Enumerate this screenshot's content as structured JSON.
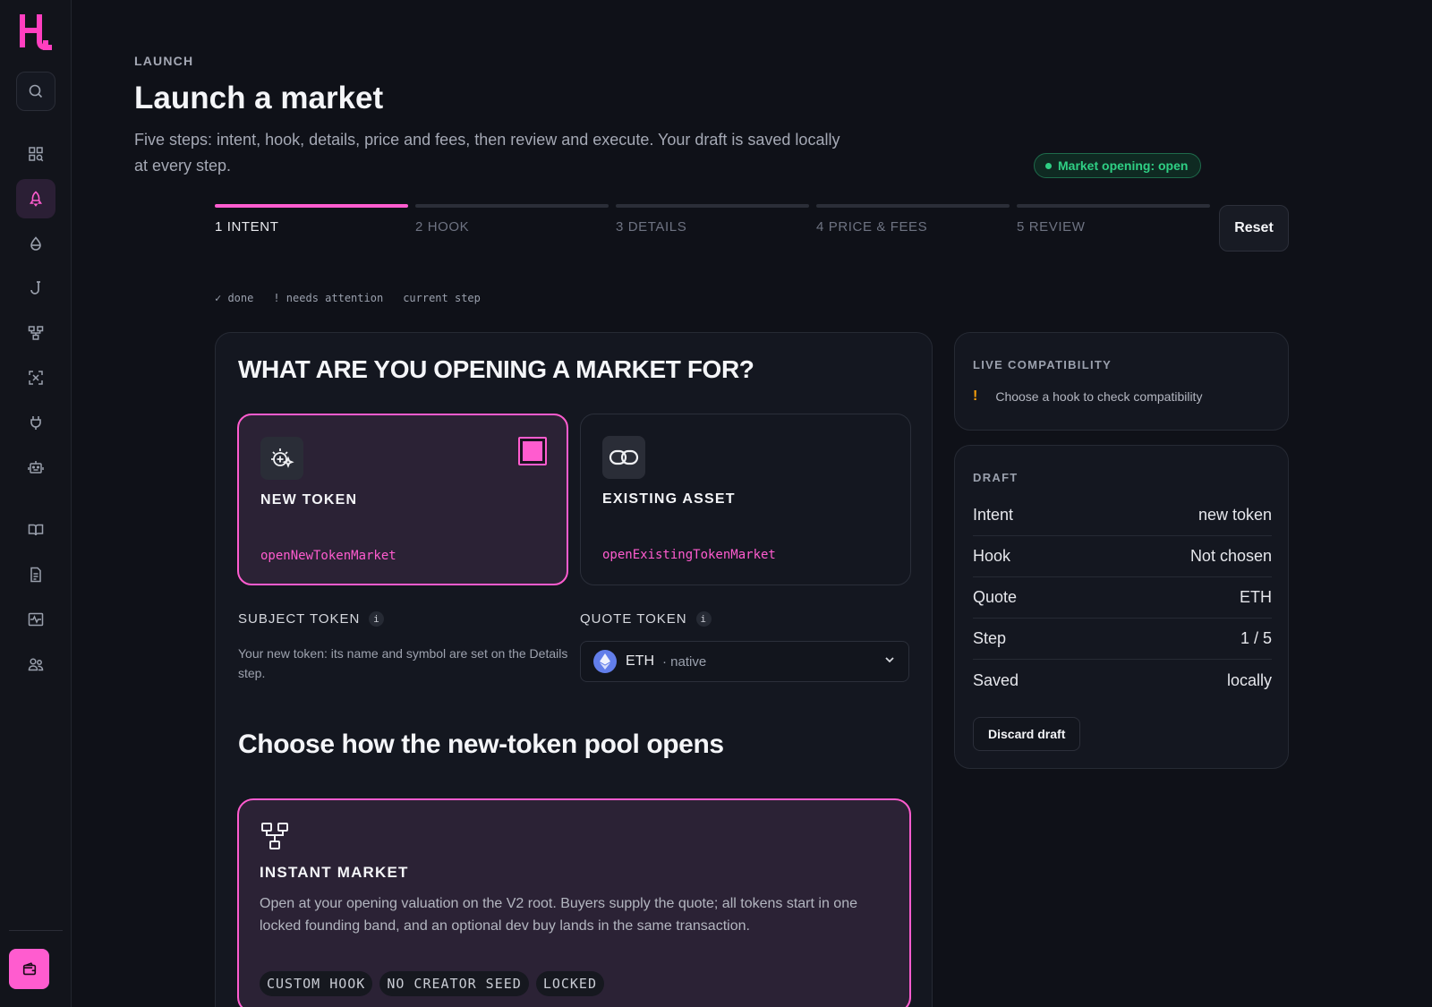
{
  "sidebar": {
    "items": [
      {
        "name": "search-icon"
      },
      {
        "name": "dashboard-icon"
      },
      {
        "name": "rocket-icon",
        "active": true
      },
      {
        "name": "drop-icon"
      },
      {
        "name": "hook-icon"
      },
      {
        "name": "network-icon"
      },
      {
        "name": "scan-icon"
      },
      {
        "name": "plug-icon"
      },
      {
        "name": "robot-icon"
      },
      {
        "name": "book-icon"
      },
      {
        "name": "document-icon"
      },
      {
        "name": "activity-icon"
      },
      {
        "name": "users-icon"
      }
    ],
    "wallet_icon": "wallet-icon",
    "accent": "#ff5ccf"
  },
  "header": {
    "eyebrow": "LAUNCH",
    "title": "Launch a market",
    "subtitle": "Five steps: intent, hook, details, price and fees, then review and execute. Your draft is saved locally at every step.",
    "status": "Market opening: open"
  },
  "stepper": {
    "steps": [
      {
        "label": "1 INTENT",
        "state": "current"
      },
      {
        "label": "2 HOOK",
        "state": "upcoming"
      },
      {
        "label": "3 DETAILS",
        "state": "upcoming"
      },
      {
        "label": "4 PRICE & FEES",
        "state": "upcoming"
      },
      {
        "label": "5 REVIEW",
        "state": "upcoming"
      }
    ],
    "reset_label": "Reset",
    "legend": [
      "✓ done",
      "! needs attention",
      "current step"
    ]
  },
  "intent": {
    "heading": "WHAT ARE YOU OPENING A MARKET FOR?",
    "options": [
      {
        "title": "NEW TOKEN",
        "function": "openNewTokenMarket",
        "selected": true,
        "icon": "sparkle-plus-icon"
      },
      {
        "title": "EXISTING ASSET",
        "function": "openExistingTokenMarket",
        "selected": false,
        "icon": "link-icon"
      }
    ],
    "subject_label": "SUBJECT TOKEN",
    "subject_desc": "Your new token: its name and symbol are set on the Details step.",
    "quote_label": "QUOTE TOKEN",
    "quote_value": "ETH",
    "quote_sub": "· native",
    "info_glyph": "i"
  },
  "hook_section": {
    "heading": "Choose how the new-token pool opens",
    "card": {
      "title": "INSTANT MARKET",
      "desc": "Open at your opening valuation on the V2 root. Buyers supply the quote; all tokens start in one locked founding band, and an optional dev buy lands in the same transaction.",
      "tags": [
        "CUSTOM HOOK",
        "NO CREATOR SEED",
        "LOCKED"
      ]
    }
  },
  "compat": {
    "label": "LIVE COMPATIBILITY",
    "warn": "!",
    "message": "Choose a hook to check compatibility"
  },
  "draft": {
    "label": "DRAFT",
    "rows": [
      {
        "k": "Intent",
        "v": "new token"
      },
      {
        "k": "Hook",
        "v": "Not chosen"
      },
      {
        "k": "Quote",
        "v": "ETH"
      },
      {
        "k": "Step",
        "v": "1 / 5"
      },
      {
        "k": "Saved",
        "v": "locally"
      }
    ],
    "discard_label": "Discard draft"
  }
}
